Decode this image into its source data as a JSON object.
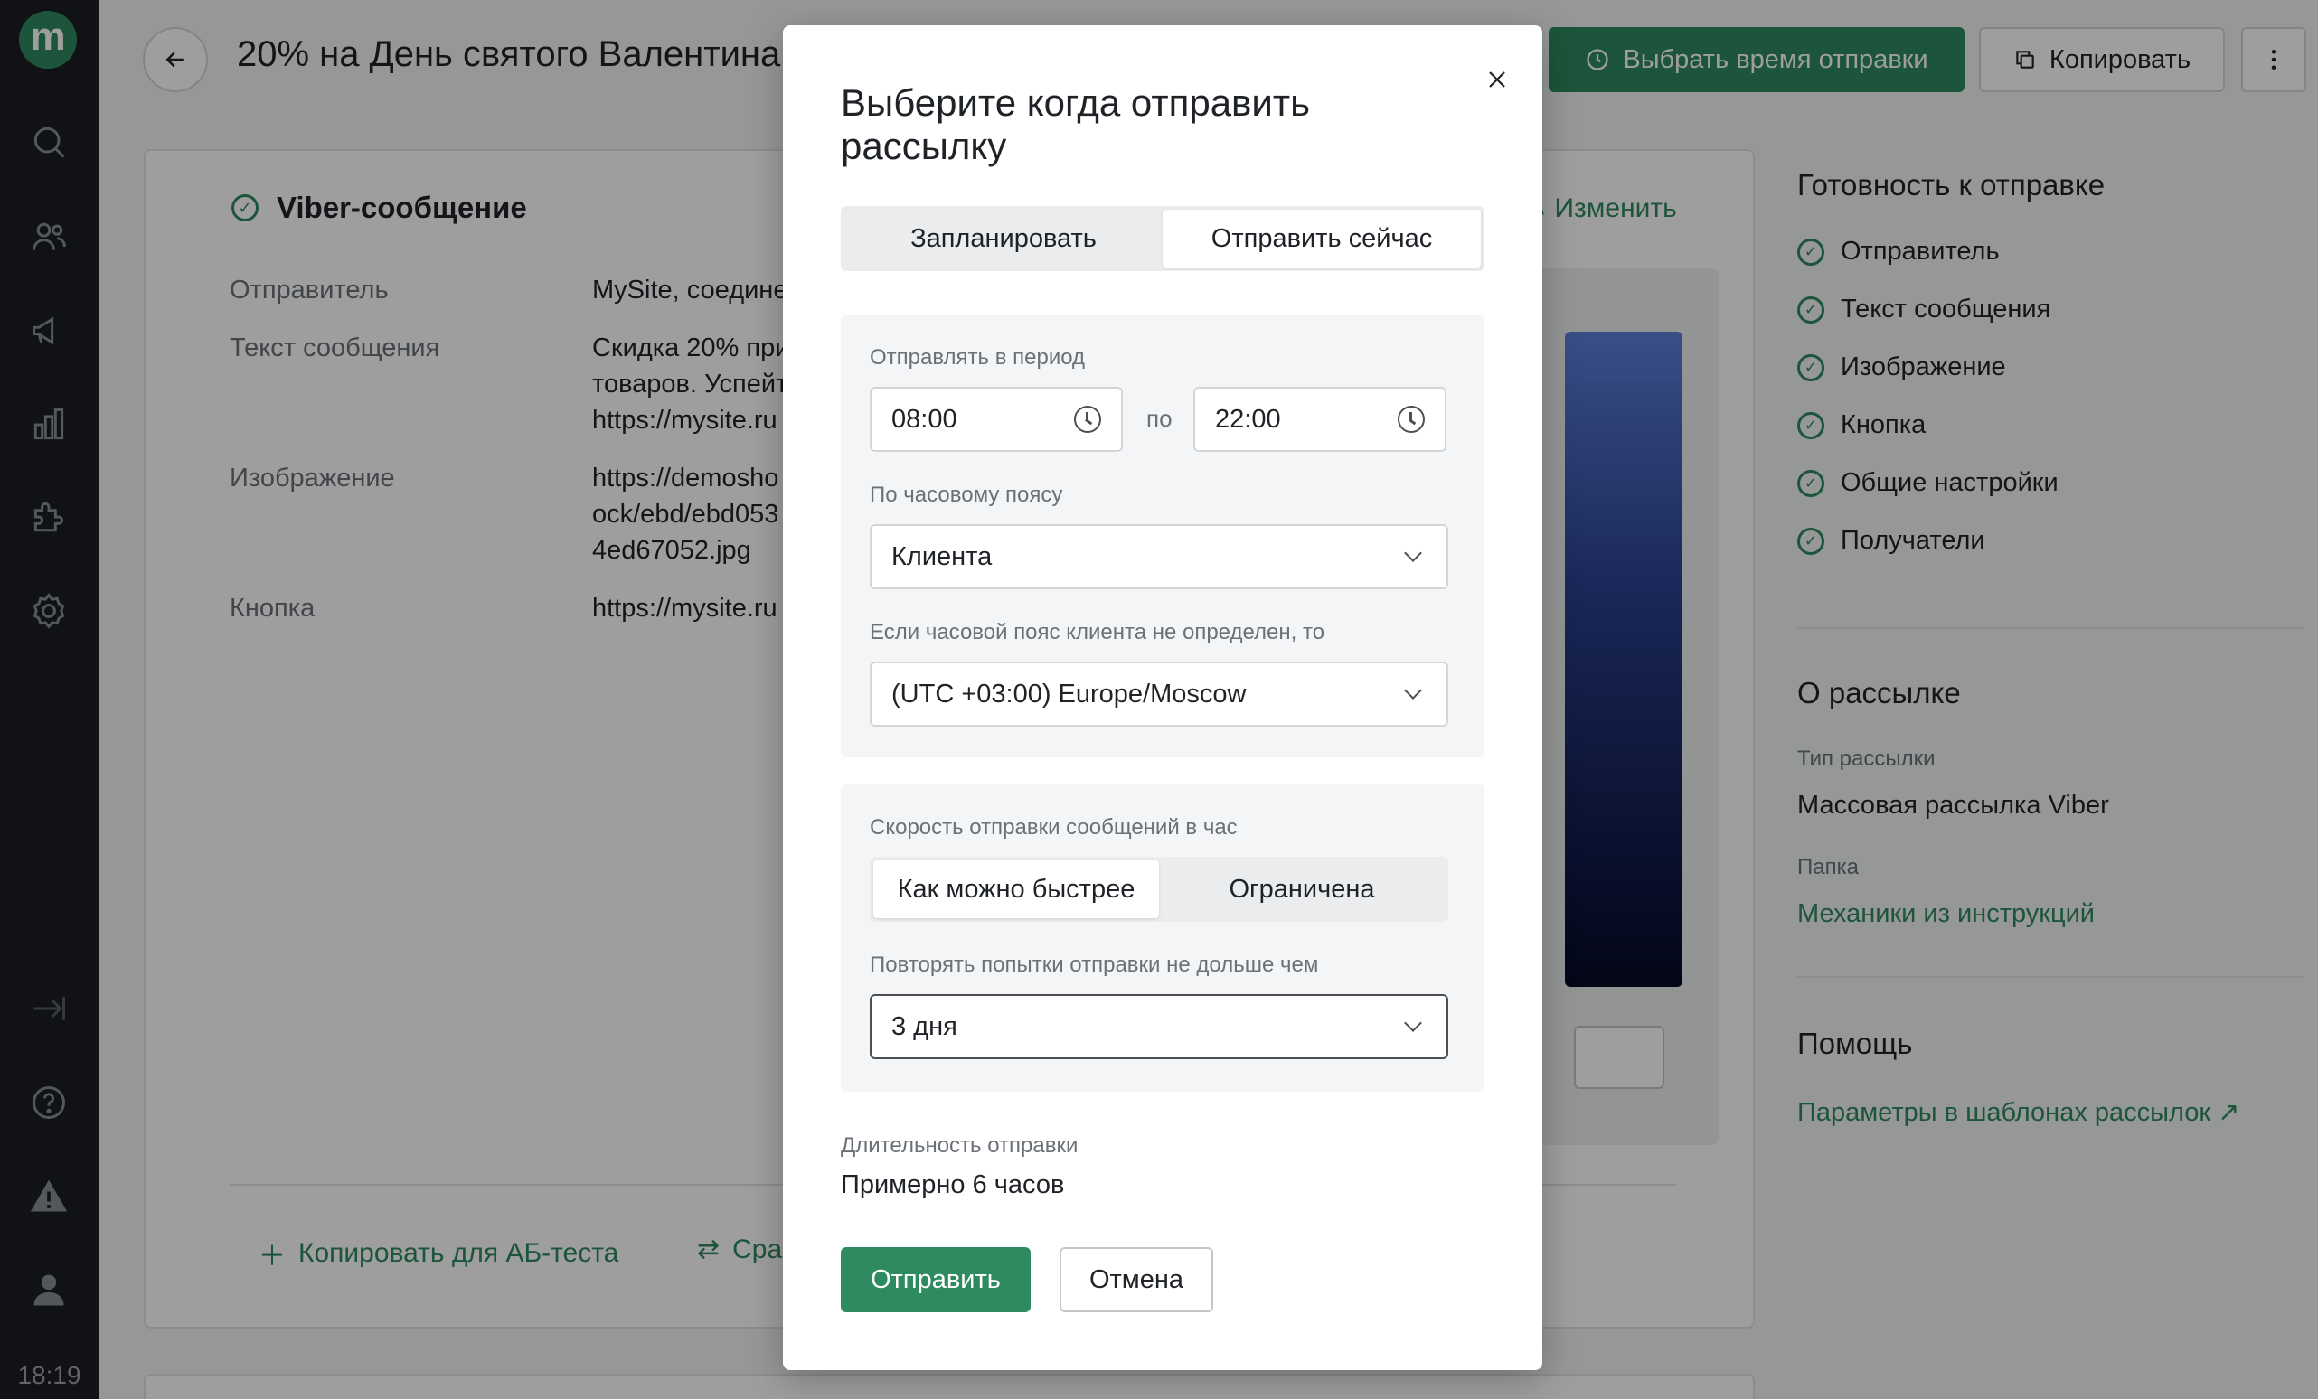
{
  "sidebar": {
    "logo": "m",
    "time": "18:19"
  },
  "header": {
    "title": "20% на День святого Валентина",
    "schedule_button": "Выбрать время отправки",
    "copy_button": "Копировать"
  },
  "card": {
    "title": "Viber-сообщение",
    "edit_label": "Изменить",
    "rows": [
      {
        "label": "Отправитель",
        "lines": [
          "MySite, соединение"
        ]
      },
      {
        "label": "Текст сообщения",
        "lines": [
          "Скидка 20% при",
          "товаров. Успейте",
          "https://mysite.ru"
        ]
      },
      {
        "label": "Изображение",
        "lines": [
          "https://demosho",
          "ock/ebd/ebd053",
          "4ed67052.jpg"
        ]
      },
      {
        "label": "Кнопка",
        "lines": [
          "https://mysite.ru"
        ]
      }
    ],
    "actions": {
      "copy_ab": "Копировать для АБ-теста",
      "compare": "Сравнить"
    }
  },
  "readiness": {
    "title": "Готовность к отправке",
    "items": [
      "Отправитель",
      "Текст сообщения",
      "Изображение",
      "Кнопка",
      "Общие настройки",
      "Получатели"
    ]
  },
  "about": {
    "title": "О рассылке",
    "type_label": "Тип рассылки",
    "type_value": "Массовая рассылка Viber",
    "folder_label": "Папка",
    "folder_value": "Механики из инструкций"
  },
  "help": {
    "title": "Помощь",
    "link": "Параметры в шаблонах рассылок"
  },
  "modal": {
    "title": "Выберите когда отправить рассылку",
    "tabs": {
      "schedule": "Запланировать",
      "send_now": "Отправить сейчас"
    },
    "period_label": "Отправлять в период",
    "time_from": "08:00",
    "time_sep": "по",
    "time_to": "22:00",
    "tz_label": "По часовому поясу",
    "tz_value": "Клиента",
    "fallback_label": "Если часовой пояс клиента не определен, то",
    "fallback_value": "(UTC +03:00) Europe/Moscow",
    "speed_label": "Скорость отправки сообщений в час",
    "speed": {
      "fast": "Как можно быстрее",
      "limited": "Ограничена"
    },
    "retry_label": "Повторять попытки отправки не дольше чем",
    "retry_value": "3 дня",
    "duration_label": "Длительность отправки",
    "duration_value": "Примерно 6 часов",
    "send_button": "Отправить",
    "cancel_button": "Отмена"
  }
}
